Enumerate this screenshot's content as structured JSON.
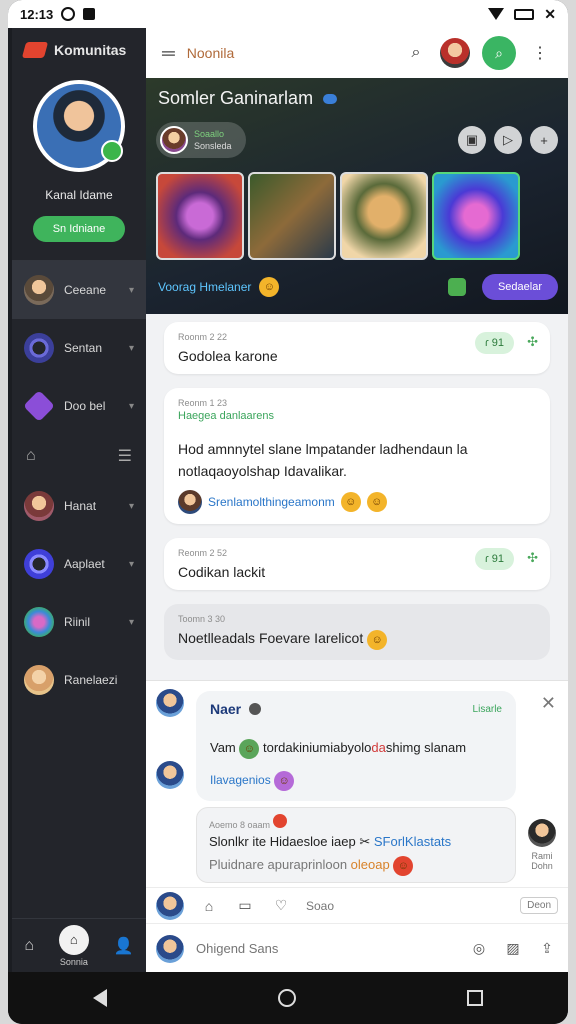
{
  "status": {
    "time": "12:13"
  },
  "sidebar": {
    "brand": "Komunitas",
    "profile_name": "Kanal Idame",
    "profile_button": "Sn Idniane",
    "items": [
      {
        "label": "Ceeane",
        "color": "#7a6a5a"
      },
      {
        "label": "Sentan",
        "color": "#3b3f9a"
      },
      {
        "label": "Doo bel",
        "color": "#8b4ed8"
      },
      {
        "label": "Hanat",
        "color": "#a05a6a"
      },
      {
        "label": "Aaplaet",
        "color": "#3f3fd8"
      },
      {
        "label": "Riinil",
        "color": "#3b8ad8"
      },
      {
        "label": "Ranelaezi",
        "color": "#d8a06a"
      }
    ],
    "bottom_label": "Sonnia"
  },
  "topbar": {
    "title": "Noonila"
  },
  "hero": {
    "title": "Somler Ganinarlam",
    "user_line1": "Soaallo",
    "user_line2": "Sonsleda",
    "tag": "Voorag Hmelaner",
    "button": "Sedaelar"
  },
  "feed": [
    {
      "meta": "Roonm 2 22",
      "text": "Godolea karone",
      "chip": "ɾ 91"
    },
    {
      "meta": "Reonm 1 23",
      "green": "Haegea danlaarens",
      "text": "Hod amnnytel slane lmpatander ladhendaun la notlaqaoyolshap Idavalikar.",
      "sub": "Srenlamolthingeamonm"
    },
    {
      "meta": "Reonm 2 52",
      "text": "Codikan lackit",
      "chip": "ɾ 91"
    },
    {
      "meta": "Toomn 3 30",
      "text": "Noetlleadals Foevare Iarelicot"
    }
  ],
  "thread": {
    "name": "Naer",
    "tag": "Lisarle",
    "body_pre": "Vam ",
    "body_mid": "tordakiniumiabyolo",
    "body_hl": "da",
    "body_post": "shimg slanam",
    "link": "Ilavagenios",
    "quote_meta": "Aoemo 8 oaam",
    "quote_line1": "Slonlkr ite Hidaesloe iaep",
    "quote_line1_blue": "SForlKlastats",
    "quote_line2": "Pluidnare apuraprinloon",
    "quote_line2_orange": "oleoap",
    "side_user_label1": "Rami",
    "side_user_label2": "Dohn"
  },
  "actions": {
    "save": "Soao",
    "done": "Deon"
  },
  "compose": {
    "placeholder": "Ohigend Sans"
  }
}
